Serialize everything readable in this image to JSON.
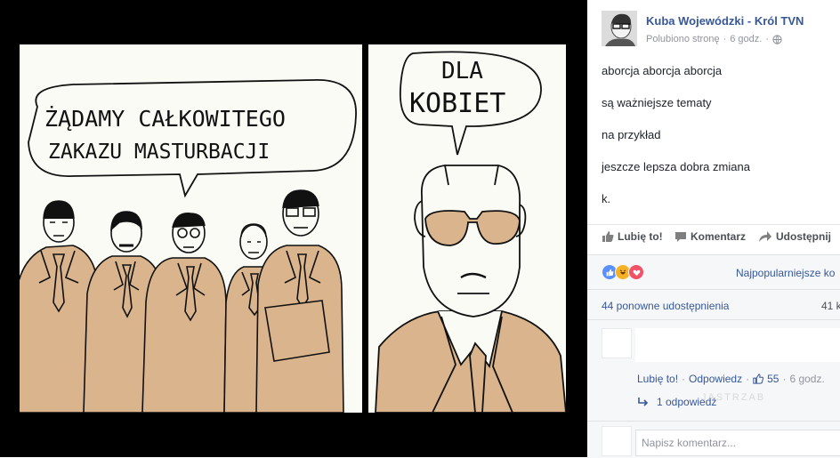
{
  "cartoon": {
    "left_caption_line1": "ŻĄDAMY CAŁKOWITEGO",
    "left_caption_line2": "ZAKAZU MASTURBACJI",
    "right_caption_line1": "DLA",
    "right_caption_line2": "KOBIET"
  },
  "post": {
    "author": "Kuba Wojewódzki - Król TVN",
    "liked_page": "Polubiono stronę",
    "time": "6 godz.",
    "lines": [
      "aborcja aborcja aborcja",
      "są ważniejsze tematy",
      "na przykład",
      "jeszcze lepsza dobra zmiana",
      "k."
    ]
  },
  "actions": {
    "like": "Lubię to!",
    "comment": "Komentarz",
    "share": "Udostępnij"
  },
  "stats": {
    "sort_label": "Najpopularniejsze ko",
    "shares": "44 ponowne udostępnienia",
    "views": "41 k"
  },
  "comment": {
    "like": "Lubię to!",
    "reply": "Odpowiedz",
    "likes_count": "55",
    "time": "6 godz.",
    "replies": "1 odpowiedź",
    "input_placeholder": "Napisz komentarz..."
  },
  "watermark": "JASTRZAB",
  "colors": {
    "link": "#365899",
    "like_blue": "#5890ff",
    "haha_yellow": "#f7b125",
    "love_red": "#f25268",
    "suit_tan": "#d9b48c"
  },
  "icons": [
    "globe-icon",
    "thumbs-up-icon",
    "comment-icon",
    "share-arrow-icon",
    "reply-arrow-icon"
  ]
}
